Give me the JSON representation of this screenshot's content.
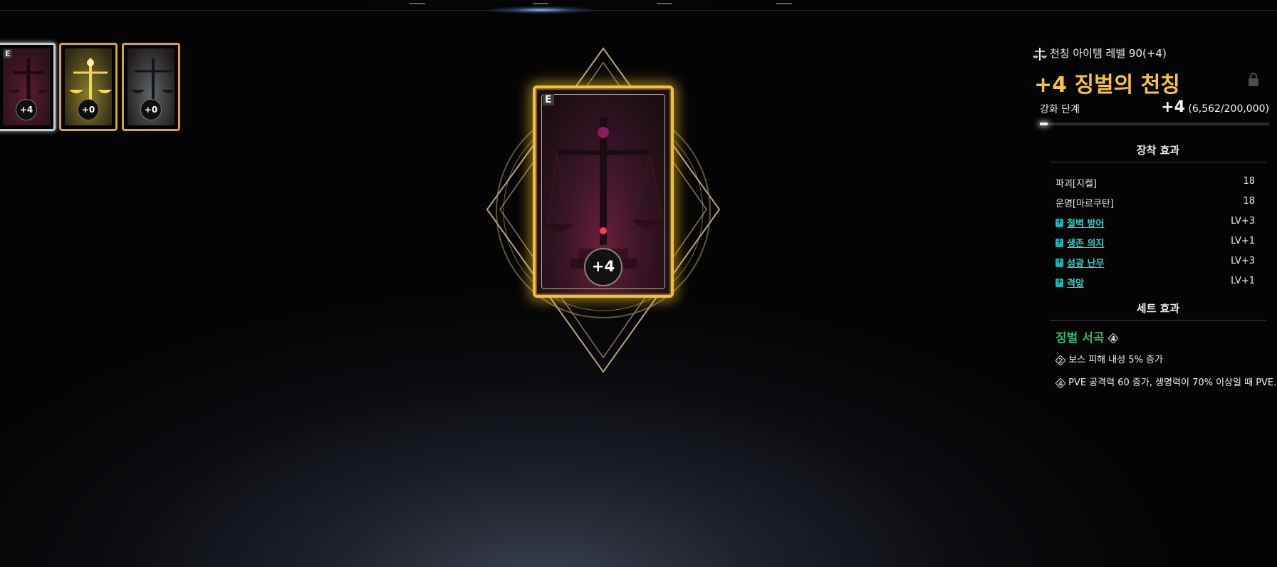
{
  "top_nav": {
    "marks": [
      1,
      2,
      3,
      4
    ]
  },
  "mini_cards": [
    {
      "tag": "E",
      "level": "+4",
      "colors": [
        "#5a1b2e",
        "#2a1218"
      ],
      "border": "#c9ccd2",
      "selected": true
    },
    {
      "tag": "",
      "level": "+0",
      "colors": [
        "#8a7a2a",
        "#2d2a12"
      ],
      "border": "#d1a43c",
      "selected": false
    },
    {
      "tag": "",
      "level": "+0",
      "colors": [
        "#5c666c",
        "#221a1a"
      ],
      "border": "#d1a43c",
      "selected": false
    }
  ],
  "main_card": {
    "tag": "E",
    "level": "+4"
  },
  "item": {
    "level_text": "천칭 아이템 레벨 90(+4)",
    "name": "+4 징벌의 천칭",
    "upgrade_label": "강화 단계",
    "upgrade_level": "+4",
    "upgrade_progress": "(6,562/200,000)",
    "upgrade_fraction": 0.033
  },
  "equip_effects": {
    "title": "장착 효과",
    "stats": [
      {
        "name": "파괴[지켈]",
        "value": "18"
      },
      {
        "name": "운명[마르쿠탄]",
        "value": "18"
      }
    ],
    "engravings": [
      {
        "name": "철벽 방어",
        "value": "LV+3"
      },
      {
        "name": "생존 의지",
        "value": "LV+1"
      },
      {
        "name": "섬광 난무",
        "value": "LV+3"
      },
      {
        "name": "격앙",
        "value": "LV+1"
      }
    ]
  },
  "set_effects": {
    "title": "세트 효과",
    "set_name": "징벌 서곡",
    "set_count": "4",
    "lines": [
      {
        "count": "2",
        "text": "보스 피해 내성 5% 증가"
      },
      {
        "count": "4",
        "text": "PVE 공격력 60 증가, 생명력이 70% 이상일 때 PVE..."
      }
    ]
  },
  "colors": {
    "gold": "#f6c43a",
    "teal": "#2fd0c8",
    "green": "#33b56a"
  }
}
